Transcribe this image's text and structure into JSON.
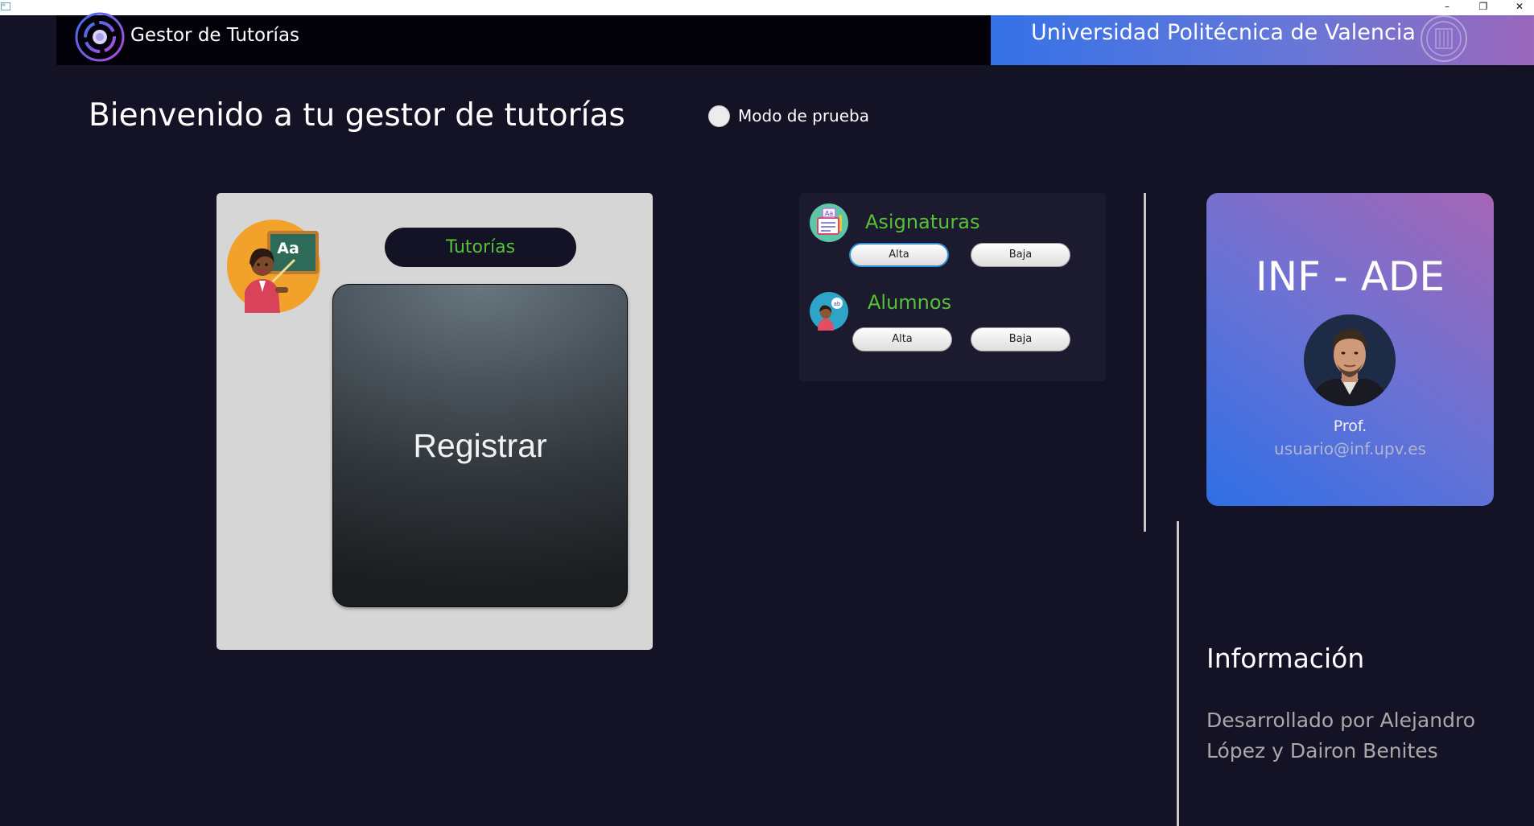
{
  "window": {
    "controls": {
      "minimize": "–",
      "restore": "❐",
      "close": "✕"
    }
  },
  "header": {
    "app_title": "Gestor de Tutorías",
    "university": "Universidad Politécnica de Valencia",
    "logo_icon": "target-ring-icon",
    "seal_icon": "university-seal-icon"
  },
  "welcome": {
    "title": "Bienvenido a tu gestor de tutorías",
    "test_mode_label": "Modo de prueba",
    "test_mode_checked": false
  },
  "tutorias_panel": {
    "section_label": "Tutorías",
    "register_button": "Registrar",
    "avatar_icon": "teacher-avatar-icon"
  },
  "management": {
    "subjects": {
      "title": "Asignaturas",
      "add_label": "Alta",
      "remove_label": "Baja",
      "icon": "subjects-book-icon"
    },
    "students": {
      "title": "Alumnos",
      "add_label": "Alta",
      "remove_label": "Baja",
      "icon": "student-avatar-icon"
    }
  },
  "profile": {
    "degree": "INF - ADE",
    "role": "Prof.",
    "email": "usuario@inf.upv.es"
  },
  "info": {
    "title": "Información",
    "body": "Desarrollado por Alejandro\nLópez  y Dairon Benites"
  },
  "colors": {
    "background": "#141225",
    "accent_green": "#56c235",
    "header_gradient_start": "#3572e8",
    "header_gradient_end": "#9a68bd"
  }
}
